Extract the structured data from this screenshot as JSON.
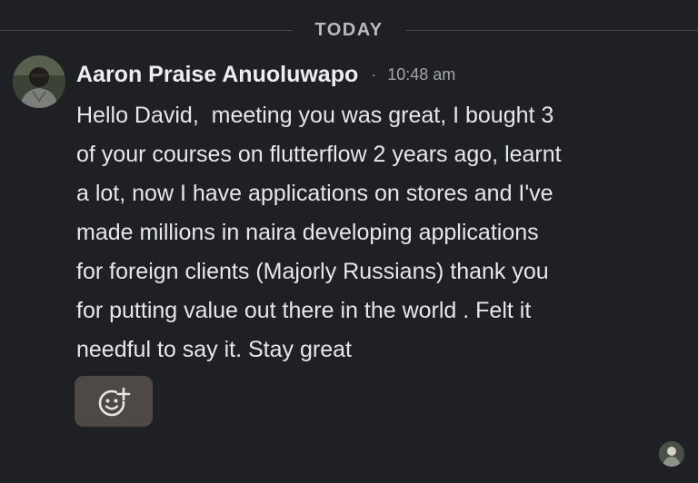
{
  "date_divider": {
    "label": "TODAY"
  },
  "message": {
    "author": "Aaron Praise Anuoluwapo",
    "separator": "·",
    "time": "10:48 am",
    "lines": [
      "Hello David,  meeting you was great, I bought 3",
      "of your courses on flutterflow 2 years ago, learnt",
      "a lot, now I have applications on stores and I've",
      "made millions in naira developing applications",
      "for foreign clients (Majorly Russians) thank you",
      "for putting value out there in the world . Felt it",
      "needful to say it. Stay great"
    ]
  },
  "reaction": {
    "icon": "add-reaction-icon"
  },
  "icons": {
    "avatar": "user-avatar-photo",
    "read_receipt": "seen-by-avatar"
  },
  "colors": {
    "background": "#1e2024",
    "text": "#e6e7e9",
    "muted": "#a3a6ab",
    "reaction_bg": "#4e4946"
  }
}
